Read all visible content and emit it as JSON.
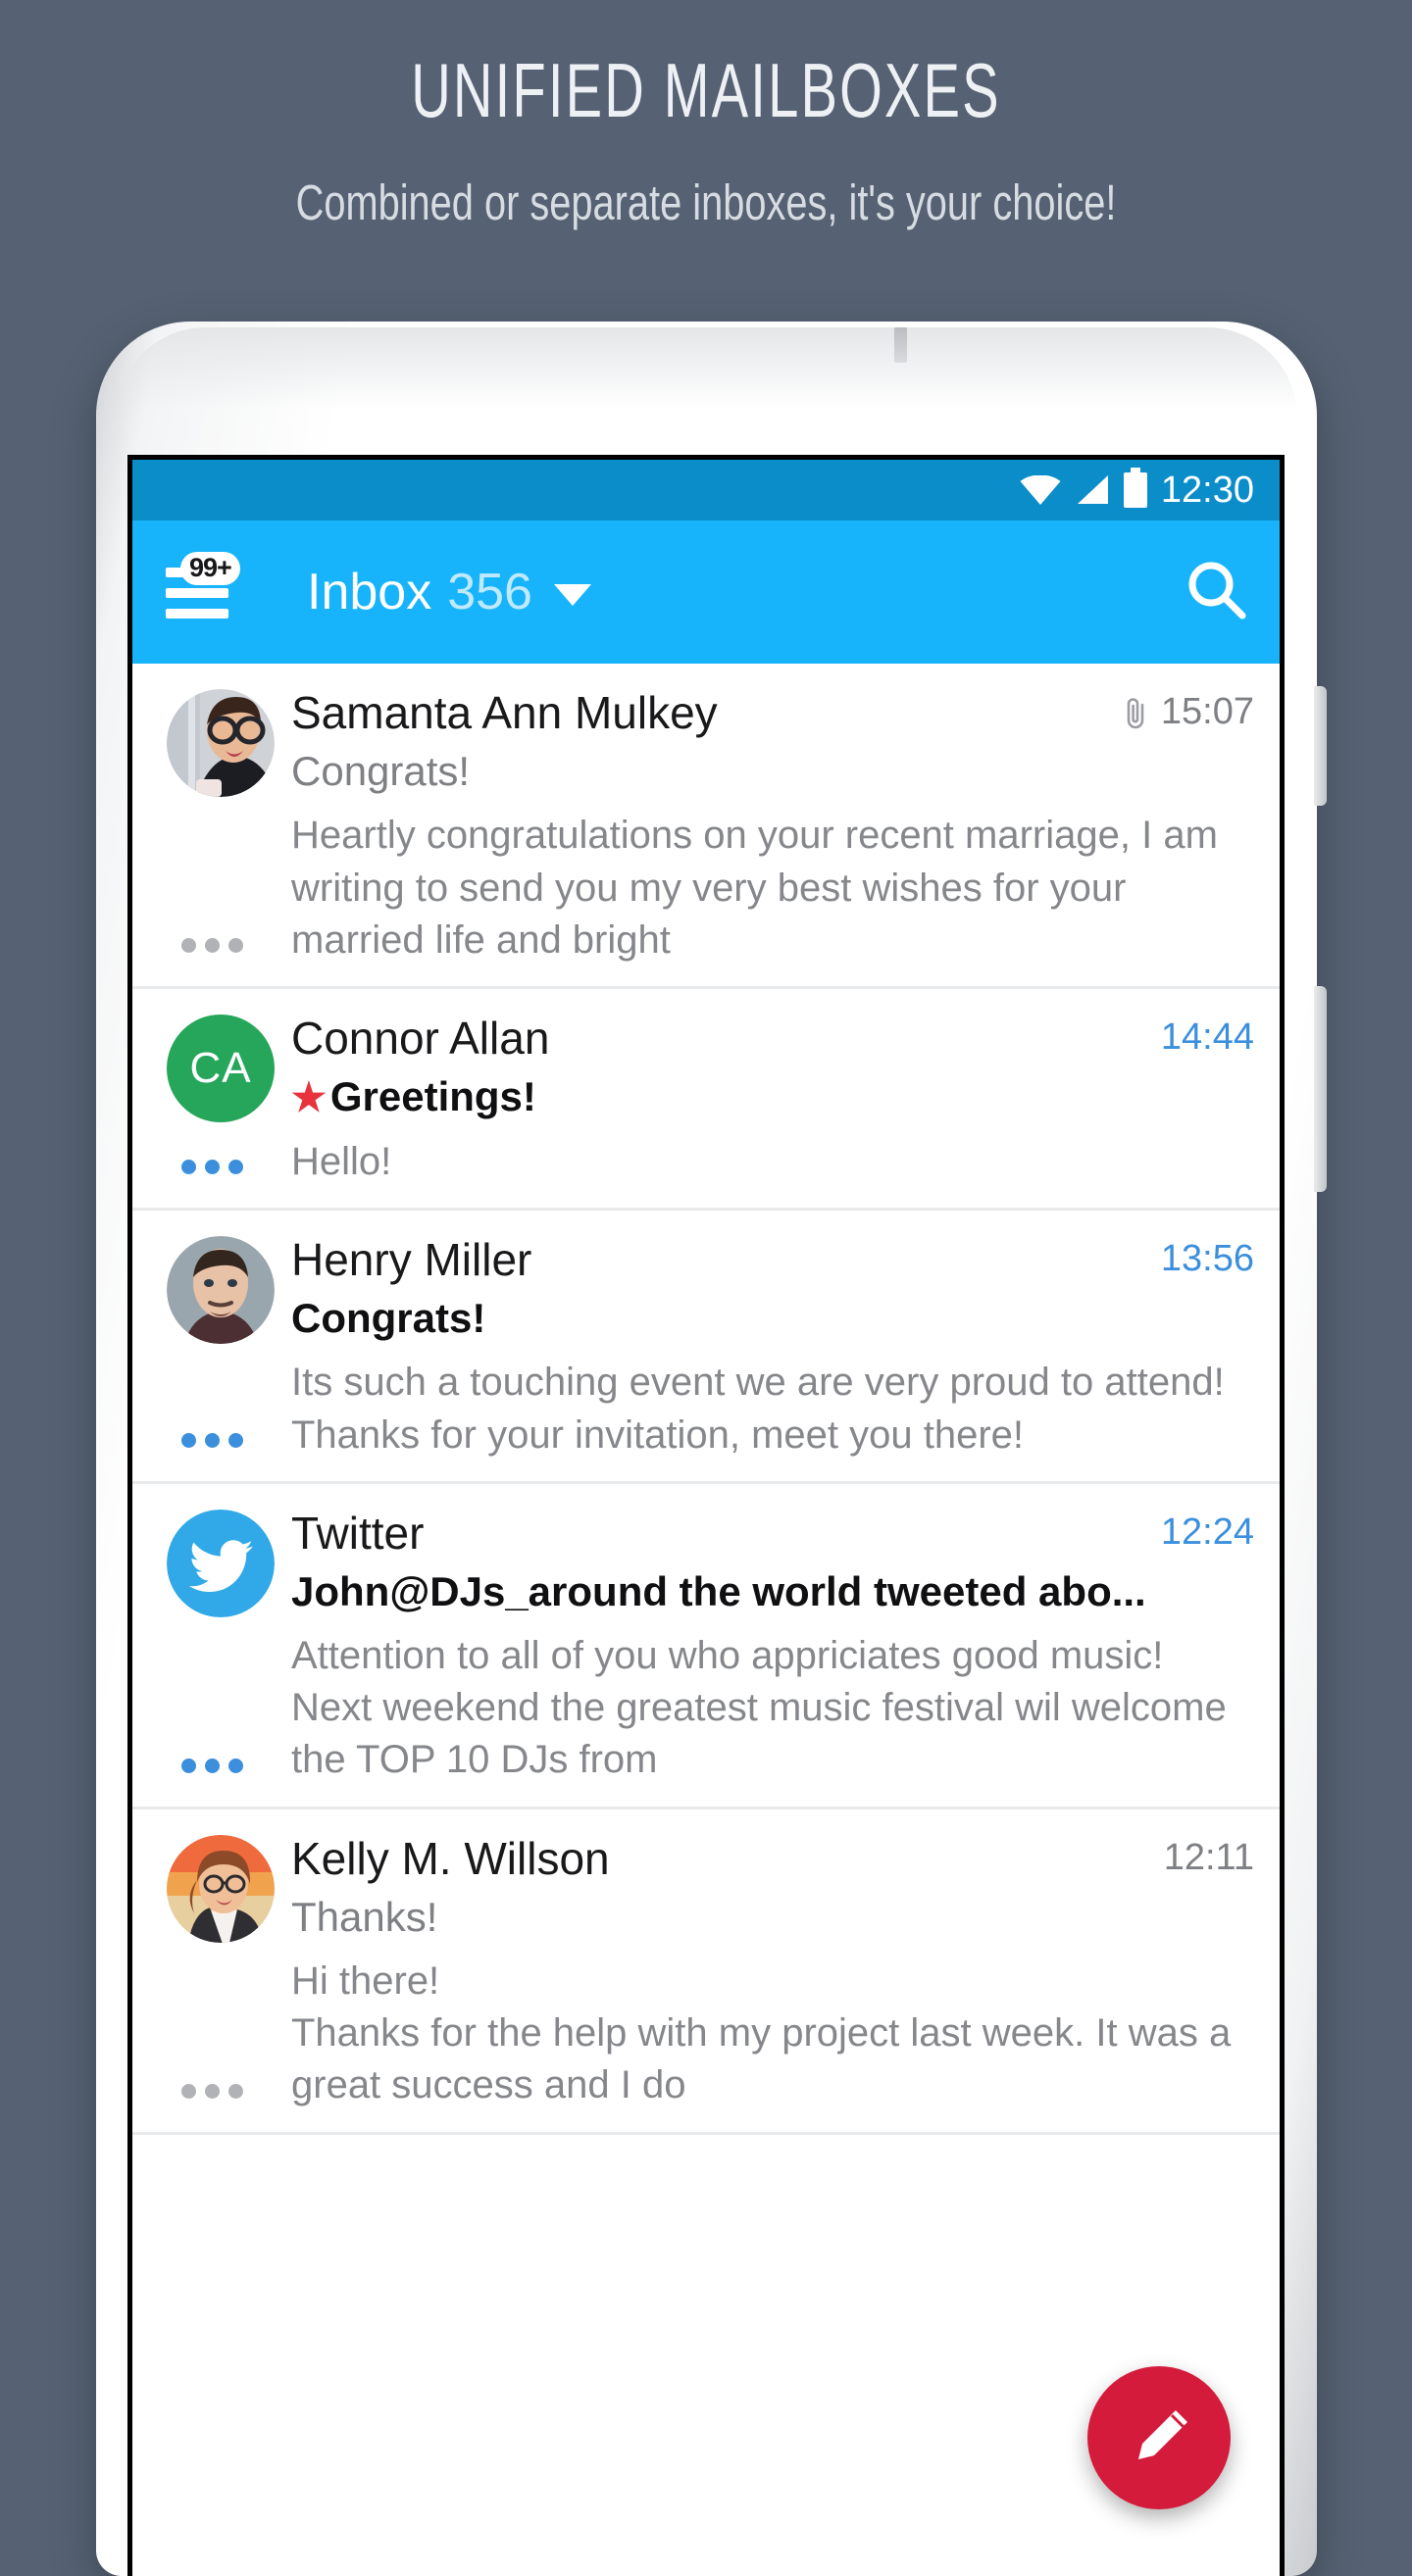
{
  "promo": {
    "title": "UNIFIED MAILBOXES",
    "subtitle": "Combined or separate inboxes, it's your choice!"
  },
  "device": {
    "camera_icon": "front-camera-icon",
    "speaker_icon": "earpiece-speaker-icon",
    "power_button": "power-button",
    "volume_button": "volume-button"
  },
  "status_bar": {
    "wifi_icon": "wifi-icon",
    "signal_icon": "cellular-signal-icon",
    "battery_icon": "battery-full-icon",
    "time": "12:30",
    "background": "#0b8dc9"
  },
  "app_bar": {
    "menu_icon": "hamburger-menu-icon",
    "menu_badge": "99+",
    "title": "Inbox",
    "count": "356",
    "caret_icon": "chevron-down-icon",
    "search_icon": "search-icon",
    "background": "#18b4fb"
  },
  "colors": {
    "page_background": "#566273",
    "accent_blue": "#18b4fb",
    "unread_blue": "#3b8fdd",
    "fab_red": "#d41b3b",
    "star_red": "#e8323c",
    "avatar_green": "#26a65b",
    "twitter_blue": "#31a9e8"
  },
  "emails": [
    {
      "sender": "Samanta Ann Mulkey",
      "subject": "Congrats!",
      "preview": "Heartly congratulations on your recent marriage, I am writing to send you my very best wishes for your married life and bright",
      "time": "15:07",
      "unread": false,
      "starred": false,
      "attachment": true,
      "avatar_type": "photo-woman-glasses",
      "initials": ""
    },
    {
      "sender": "Connor Allan",
      "subject": "Greetings!",
      "preview": "Hello!",
      "time": "14:44",
      "unread": true,
      "starred": true,
      "attachment": false,
      "avatar_type": "initials",
      "initials": "CA"
    },
    {
      "sender": "Henry Miller",
      "subject": "Congrats!",
      "preview": "Its such a touching event we are very proud to attend! Thanks for your invitation, meet you there!",
      "time": "13:56",
      "unread": true,
      "starred": false,
      "attachment": false,
      "avatar_type": "photo-man",
      "initials": ""
    },
    {
      "sender": "Twitter",
      "subject": "John@DJs_around the world tweeted abo...",
      "preview": "Attention to all of you who appriciates good music! Next weekend the greatest music festival wil welcome the TOP 10 DJs from",
      "time": "12:24",
      "unread": true,
      "starred": false,
      "attachment": false,
      "avatar_type": "twitter-logo",
      "initials": ""
    },
    {
      "sender": "Kelly M. Willson",
      "subject": "Thanks!",
      "preview": "Hi there!\nThanks for the help with my project last week. It was a great success and I do",
      "time": "12:11",
      "unread": false,
      "starred": false,
      "attachment": false,
      "avatar_type": "photo-woman-orange",
      "initials": ""
    }
  ],
  "fab": {
    "icon": "compose-pencil-icon",
    "label": "Compose"
  }
}
